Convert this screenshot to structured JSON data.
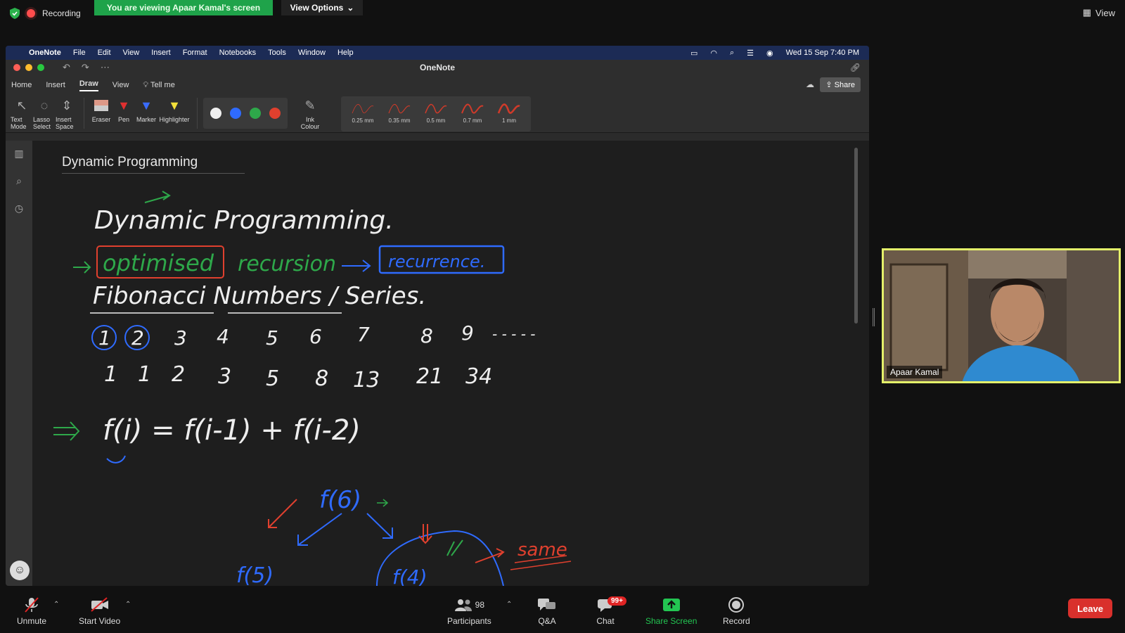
{
  "zoom": {
    "recording_label": "Recording",
    "viewing_banner": "You are viewing Apaar Kamal's screen",
    "view_options_label": "View Options",
    "view_label": "View",
    "participant_name": "Apaar Kamal",
    "participants_count": "98",
    "chat_badge": "99+",
    "leave_label": "Leave",
    "toolbar": [
      {
        "label": "Unmute",
        "icon": "mic-muted-icon"
      },
      {
        "label": "Start Video",
        "icon": "video-off-icon"
      },
      {
        "label": "Participants",
        "icon": "participants-icon"
      },
      {
        "label": "Q&A",
        "icon": "qa-icon"
      },
      {
        "label": "Chat",
        "icon": "chat-icon"
      },
      {
        "label": "Share Screen",
        "icon": "share-screen-icon"
      },
      {
        "label": "Record",
        "icon": "record-icon"
      }
    ]
  },
  "mac": {
    "menu": [
      "OneNote",
      "File",
      "Edit",
      "View",
      "Insert",
      "Format",
      "Notebooks",
      "Tools",
      "Window",
      "Help"
    ],
    "datetime": "Wed 15 Sep  7:40 PM"
  },
  "onenote": {
    "window_title": "OneNote",
    "tabs": [
      "Home",
      "Insert",
      "Draw",
      "View",
      "Tell me"
    ],
    "active_tab": "Draw",
    "share_label": "Share",
    "ribbon_tools": [
      {
        "label": "Text Mode",
        "icon": "text-mode-icon"
      },
      {
        "label": "Lasso Select",
        "icon": "lasso-icon"
      },
      {
        "label": "Insert Space",
        "icon": "insert-space-icon"
      },
      {
        "label": "Eraser",
        "icon": "eraser-icon"
      },
      {
        "label": "Pen",
        "icon": "pen-icon"
      },
      {
        "label": "Marker",
        "icon": "marker-icon"
      },
      {
        "label": "Highlighter",
        "icon": "highlighter-icon"
      }
    ],
    "palette": [
      "#f0f0f0",
      "#2f6bff",
      "#2ea84a",
      "#e0402e"
    ],
    "ink_colour_label": "Ink Colour",
    "pen_sizes": [
      "0.25 mm",
      "0.35 mm",
      "0.5 mm",
      "0.7 mm",
      "1 mm"
    ],
    "page_title": "Dynamic Programming"
  },
  "ink_notes": {
    "line1": "Dynamic Programming.",
    "line2_boxed": "optimised",
    "line2_rest": "recursion",
    "line2_box2": "recurrence.",
    "line3": "Fibonacci Numbers / Series.",
    "indices": [
      "1",
      "2",
      "3",
      "4",
      "5",
      "6",
      "7",
      "8",
      "9",
      "- - - - -"
    ],
    "values": [
      "1",
      "1",
      "2",
      "3",
      "5",
      "8",
      "13",
      "21",
      "34"
    ],
    "formula": "f(i) = f(i-1) + f(i-2)",
    "tree_root": "f(6)",
    "tree_left": "f(5)",
    "tree_right": "f(4)",
    "same": "same"
  }
}
